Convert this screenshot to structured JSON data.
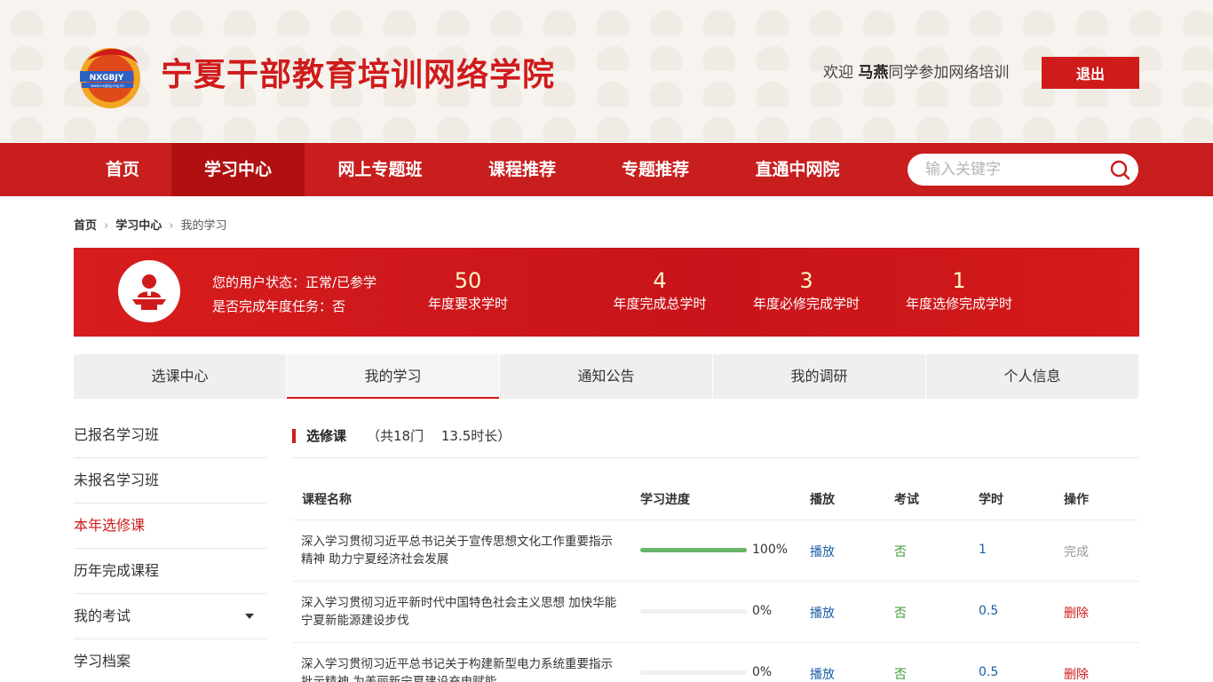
{
  "header": {
    "logo_text": "NXGBJY",
    "logo_url": "www.nxgbjy.org.cn",
    "title": "宁夏干部教育培训网络学院",
    "welcome_prefix": "欢迎 ",
    "user_name": "马燕",
    "welcome_suffix": "同学参加网络培训",
    "logout_label": "退出"
  },
  "nav": {
    "items": [
      {
        "label": "首页"
      },
      {
        "label": "学习中心",
        "active": true
      },
      {
        "label": "网上专题班"
      },
      {
        "label": "课程推荐"
      },
      {
        "label": "专题推荐"
      },
      {
        "label": "直通中网院"
      }
    ],
    "search_placeholder": "输入关键字"
  },
  "breadcrumb": [
    "首页",
    "学习中心",
    "我的学习"
  ],
  "banner": {
    "status_line": "您的用户状态：正常/已参学",
    "task_line": "是否完成年度任务：否",
    "stats": [
      {
        "value": "50",
        "label": "年度要求学时"
      },
      {
        "value": "4",
        "label": "年度完成总学时"
      },
      {
        "value": "3",
        "label": "年度必修完成学时"
      },
      {
        "value": "1",
        "label": "年度选修完成学时"
      }
    ]
  },
  "tabs": [
    {
      "label": "选课中心"
    },
    {
      "label": "我的学习",
      "active": true
    },
    {
      "label": "通知公告"
    },
    {
      "label": "我的调研"
    },
    {
      "label": "个人信息"
    }
  ],
  "sidebar": [
    {
      "label": "已报名学习班"
    },
    {
      "label": "未报名学习班"
    },
    {
      "label": "本年选修课",
      "active": true
    },
    {
      "label": "历年完成课程"
    },
    {
      "label": "我的考试",
      "has_dropdown": true
    },
    {
      "label": "学习档案"
    }
  ],
  "section": {
    "title": "选修课",
    "meta": "（共18门　 13.5时长）"
  },
  "table": {
    "headers": [
      "课程名称",
      "学习进度",
      "播放",
      "考试",
      "学时",
      "操作"
    ],
    "rows": [
      {
        "name": "深入学习贯彻习近平总书记关于宣传思想文化工作重要指示精神 助力宁夏经济社会发展",
        "progress": 100,
        "progress_text": "100%",
        "play": "播放",
        "exam": "否",
        "hours": "1",
        "op": "完成",
        "op_type": "done"
      },
      {
        "name": "深入学习贯彻习近平新时代中国特色社会主义思想 加快华能宁夏新能源建设步伐",
        "progress": 0,
        "progress_text": "0%",
        "play": "播放",
        "exam": "否",
        "hours": "0.5",
        "op": "删除",
        "op_type": "del"
      },
      {
        "name": "深入学习贯彻习近平总书记关于构建新型电力系统重要指示批示精神 为美丽新宁夏建设充电赋能",
        "progress": 0,
        "progress_text": "0%",
        "play": "播放",
        "exam": "否",
        "hours": "0.5",
        "op": "删除",
        "op_type": "del"
      }
    ]
  },
  "colors": {
    "brand_red": "#cf1b1b",
    "nav_red": "#c81e1e",
    "nav_active": "#b01010",
    "link_blue": "#1b5ea8",
    "exam_green": "#3a9b2f",
    "progress_green": "#6bb56b"
  }
}
